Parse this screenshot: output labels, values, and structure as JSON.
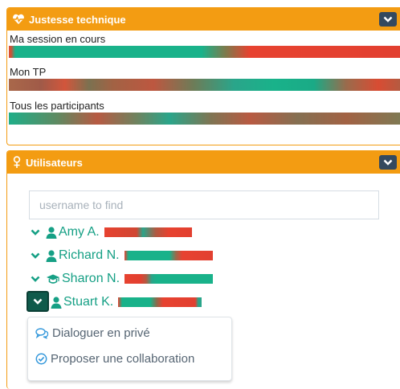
{
  "technique_panel": {
    "title": "Justesse technique",
    "heart_icon": "heartbeat-icon",
    "collapse_icon": "chevron-down-icon",
    "rows": [
      {
        "label": "Ma session en cours"
      },
      {
        "label": "Mon TP"
      },
      {
        "label": "Tous les participants"
      }
    ]
  },
  "users_panel": {
    "title": "Utilisateurs",
    "title_icon": "user-female-icon",
    "collapse_icon": "chevron-down-icon",
    "search_placeholder": "username to find",
    "users": [
      {
        "name": "Amy A.",
        "icon": "user-icon",
        "expanded": false
      },
      {
        "name": "Richard N.",
        "icon": "user-icon",
        "expanded": false
      },
      {
        "name": "Sharon N.",
        "icon": "graduation-cap-icon",
        "expanded": false
      },
      {
        "name": "Stuart K.",
        "icon": "user-icon",
        "expanded": true
      }
    ],
    "menu": [
      {
        "label": "Dialoguer en privé",
        "icon": "comments-icon"
      },
      {
        "label": "Proposer une collaboration",
        "icon": "check-circle-icon"
      }
    ]
  },
  "colors": {
    "accent": "#f39c12",
    "user_green": "#16a085",
    "bar_green": "#19b28a",
    "bar_red": "#e74230",
    "dark_button": "#34495e"
  }
}
